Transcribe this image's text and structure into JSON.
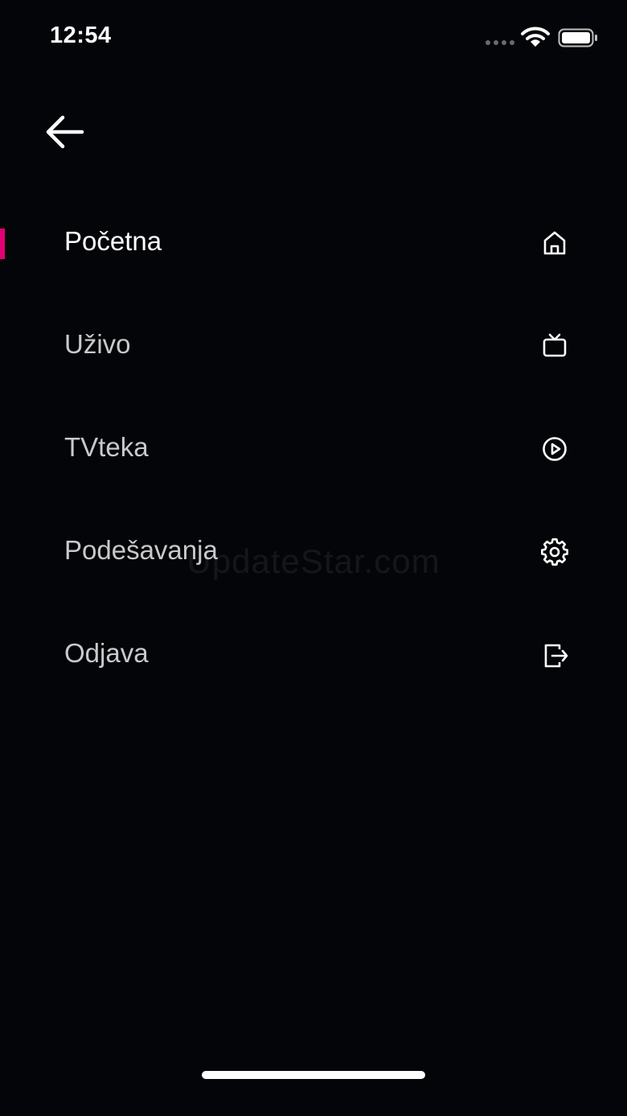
{
  "status_bar": {
    "time": "12:54",
    "signal_icon": "signal-dots-icon",
    "wifi_icon": "wifi-icon",
    "battery_icon": "battery-full-icon"
  },
  "header": {
    "back_icon": "arrow-left-icon"
  },
  "menu": {
    "items": [
      {
        "label": "Početna",
        "icon": "home-icon",
        "active": true
      },
      {
        "label": "Uživo",
        "icon": "tv-icon",
        "active": false
      },
      {
        "label": "TVteka",
        "icon": "play-circle-icon",
        "active": false
      },
      {
        "label": "Podešavanja",
        "icon": "gear-icon",
        "active": false
      },
      {
        "label": "Odjava",
        "icon": "logout-icon",
        "active": false
      }
    ]
  },
  "watermark": "UpdateStar.com",
  "colors": {
    "background": "#040508",
    "accent": "#e20074",
    "active_text": "#ffffff",
    "inactive_text": "#c9c9cc"
  }
}
